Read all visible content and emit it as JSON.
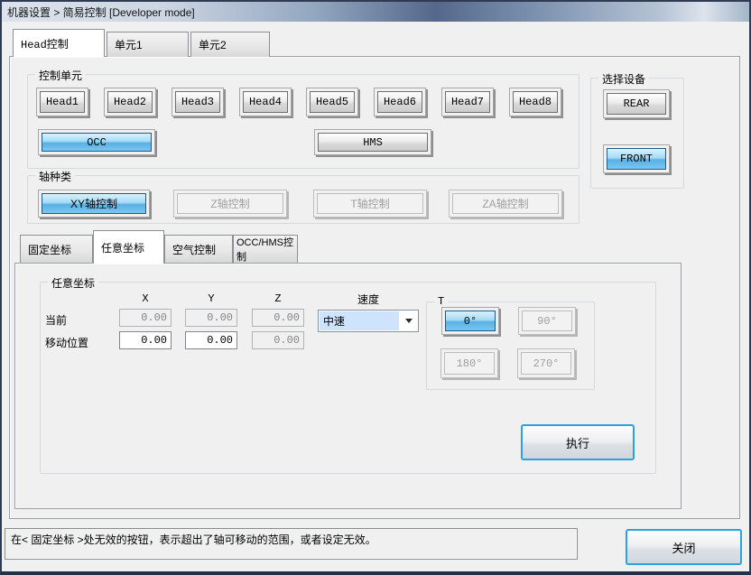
{
  "window": {
    "title": "机器设置 > 简易控制 [Developer mode]"
  },
  "colors": {
    "selected_button_blue": "#57b1e4",
    "focus_border_blue": "#2ba2dd",
    "combo_highlight": "#cde4fc",
    "titlebar_slate": "#55688b",
    "dialog_background": "#f0f0f0"
  },
  "tabs_main": [
    {
      "label": "Head控制",
      "active": true
    },
    {
      "label": "单元1",
      "active": false
    },
    {
      "label": "单元2",
      "active": false
    }
  ],
  "control_unit": {
    "title": "控制单元",
    "head_buttons": [
      "Head1",
      "Head2",
      "Head3",
      "Head4",
      "Head5",
      "Head6",
      "Head7",
      "Head8"
    ],
    "occ_label": "OCC",
    "hms_label": "HMS"
  },
  "device_select": {
    "title": "选择设备",
    "rear_label": "REAR",
    "front_label": "FRONT"
  },
  "axis_type": {
    "title": "轴种类",
    "buttons": [
      {
        "label": "XY轴控制",
        "state": "selected"
      },
      {
        "label": "Z轴控制",
        "state": "disabled"
      },
      {
        "label": "T轴控制",
        "state": "disabled"
      },
      {
        "label": "ZA轴控制",
        "state": "disabled"
      }
    ]
  },
  "tabs_sub": [
    {
      "label": "固定坐标",
      "active": false
    },
    {
      "label": "任意坐标",
      "active": true
    },
    {
      "label": "空气控制",
      "active": false
    },
    {
      "label": "OCC/HMS控制",
      "active": false
    }
  ],
  "coords": {
    "title": "任意坐标",
    "col_headers": [
      "X",
      "Y",
      "Z"
    ],
    "rows": [
      {
        "label": "当前",
        "x": "0.00",
        "y": "0.00",
        "z": "0.00"
      },
      {
        "label": "移动位置",
        "x": "0.00",
        "y": "0.00",
        "z": "0.00"
      }
    ],
    "speed": {
      "label": "速度",
      "value": "中速"
    },
    "t_group": {
      "label": "T",
      "buttons": [
        {
          "label": "0°",
          "state": "selected"
        },
        {
          "label": "90°",
          "state": "disabled"
        },
        {
          "label": "180°",
          "state": "disabled"
        },
        {
          "label": "270°",
          "state": "disabled"
        }
      ]
    },
    "execute_label": "执行"
  },
  "status_text": "在< 固定坐标 >处无效的按钮，表示超出了轴可移动的范围，或者设定无效。",
  "close_label": "关闭"
}
